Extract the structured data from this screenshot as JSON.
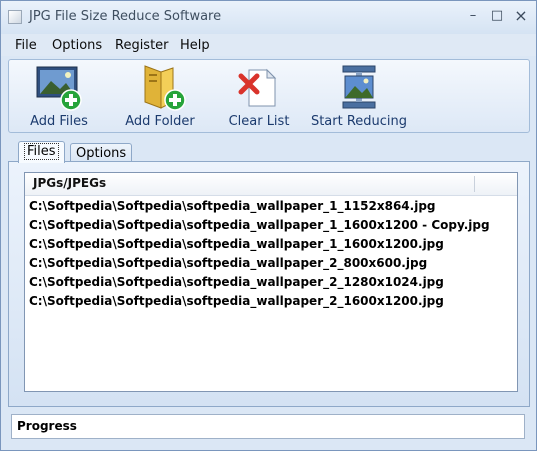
{
  "window": {
    "title": "JPG File Size Reduce Software",
    "controls": {
      "minimize": "–",
      "maximize": "□",
      "close": "×"
    }
  },
  "menu": [
    "File",
    "Options",
    "Register",
    "Help"
  ],
  "toolbar": [
    {
      "label": "Add Files",
      "icon": "add-files-icon"
    },
    {
      "label": "Add Folder",
      "icon": "add-folder-icon"
    },
    {
      "label": "Clear List",
      "icon": "clear-list-icon"
    },
    {
      "label": "Start Reducing",
      "icon": "compress-icon"
    }
  ],
  "tabs": {
    "files": "Files",
    "options": "Options"
  },
  "list": {
    "column_header": "JPGs/JPEGs",
    "rows": [
      "C:\\Softpedia\\Softpedia\\softpedia_wallpaper_1_1152x864.jpg",
      "C:\\Softpedia\\Softpedia\\softpedia_wallpaper_1_1600x1200 - Copy.jpg",
      "C:\\Softpedia\\Softpedia\\softpedia_wallpaper_1_1600x1200.jpg",
      "C:\\Softpedia\\Softpedia\\softpedia_wallpaper_2_800x600.jpg",
      "C:\\Softpedia\\Softpedia\\softpedia_wallpaper_2_1280x1024.jpg",
      "C:\\Softpedia\\Softpedia\\softpedia_wallpaper_2_1600x1200.jpg"
    ]
  },
  "progress": {
    "label": "Progress"
  },
  "colors": {
    "window_bg": "#dbe7f5",
    "toolbar_text": "#1c3b6e",
    "accent_green": "#27a43a",
    "accent_red": "#d9332b"
  }
}
